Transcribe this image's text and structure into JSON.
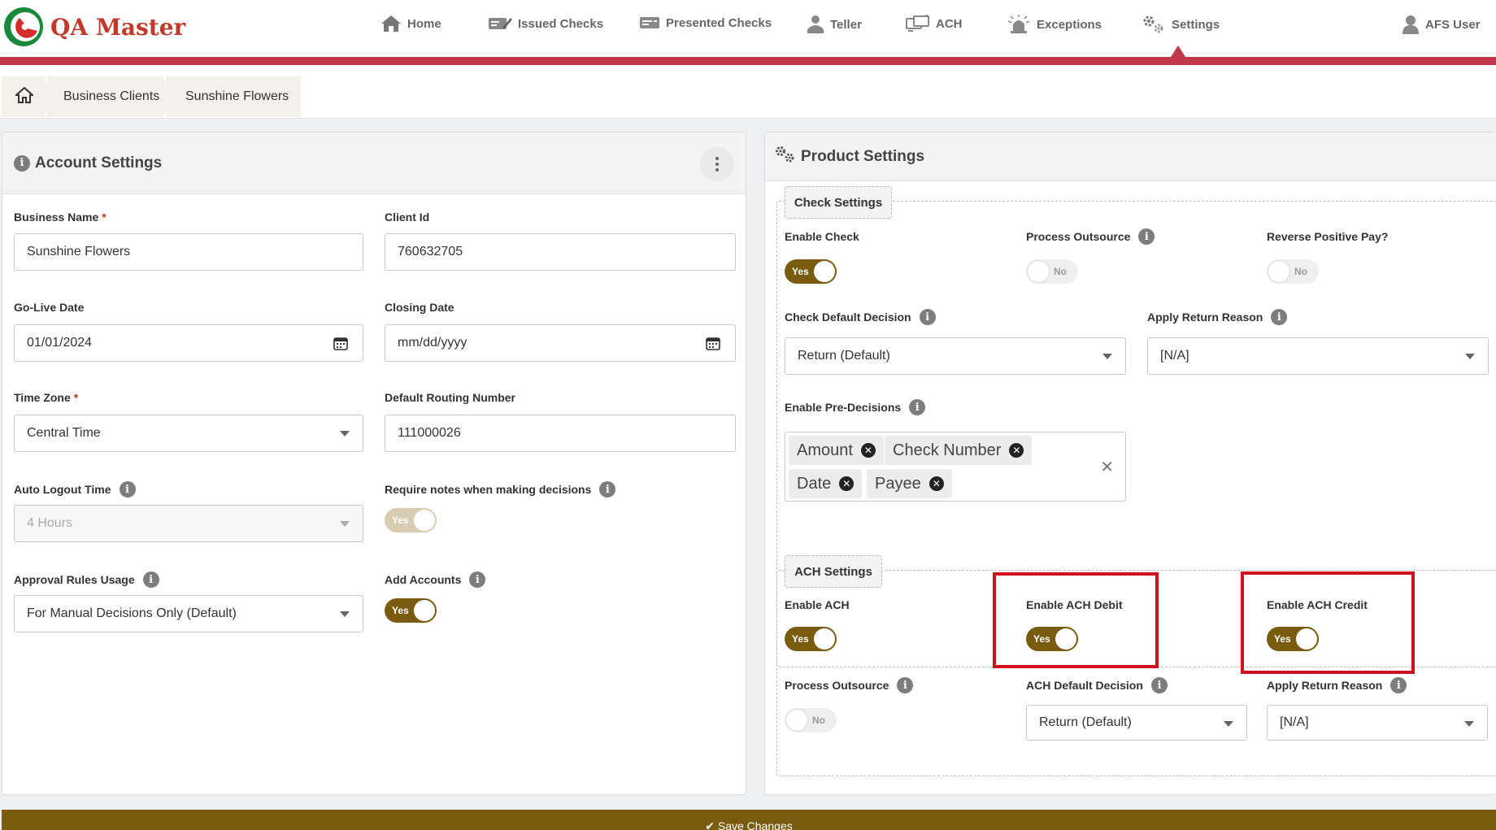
{
  "app": {
    "title": "QA Master"
  },
  "nav": {
    "home": "Home",
    "issued_checks": "Issued Checks",
    "presented_checks": "Presented Checks",
    "teller": "Teller",
    "ach": "ACH",
    "exceptions": "Exceptions",
    "settings": "Settings",
    "user": "AFS User"
  },
  "breadcrumb": {
    "items": [
      "Business Clients",
      "Sunshine Flowers"
    ]
  },
  "account": {
    "title": "Account Settings",
    "business_name_label": "Business Name",
    "business_name_value": "Sunshine Flowers",
    "client_id_label": "Client Id",
    "client_id_value": "760632705",
    "go_live_label": "Go-Live Date",
    "go_live_value": "01/01/2024",
    "closing_label": "Closing Date",
    "closing_placeholder": "mm/dd/yyyy",
    "timezone_label": "Time Zone",
    "timezone_value": "Central Time",
    "routing_label": "Default Routing Number",
    "routing_value": "111000026",
    "auto_logout_label": "Auto Logout Time",
    "auto_logout_value": "4 Hours",
    "require_notes_label": "Require notes when making decisions",
    "require_notes_toggle": "Yes",
    "approval_label": "Approval Rules Usage",
    "approval_value": "For Manual Decisions Only (Default)",
    "add_accounts_label": "Add Accounts",
    "add_accounts_toggle": "Yes",
    "required_mark": "*"
  },
  "product": {
    "title": "Product Settings",
    "check_legend": "Check Settings",
    "enable_check_label": "Enable Check",
    "enable_check_toggle": "Yes",
    "process_outsource_label": "Process Outsource",
    "process_outsource_toggle": "No",
    "reverse_pp_label": "Reverse Positive Pay?",
    "reverse_pp_toggle": "No",
    "check_default_label": "Check Default Decision",
    "check_default_value": "Return (Default)",
    "apply_return_label": "Apply Return Reason",
    "apply_return_value": "[N/A]",
    "pre_decisions_label": "Enable Pre-Decisions",
    "chips": [
      "Amount",
      "Check Number",
      "Date",
      "Payee"
    ],
    "ach_legend": "ACH Settings",
    "enable_ach_label": "Enable ACH",
    "enable_ach_toggle": "Yes",
    "ach_debit_label": "Enable ACH Debit",
    "ach_debit_toggle": "Yes",
    "ach_credit_label": "Enable ACH Credit",
    "ach_credit_toggle": "Yes",
    "ach_outsource_label": "Process Outsource",
    "ach_outsource_toggle": "No",
    "ach_default_label": "ACH Default Decision",
    "ach_default_value": "Return (Default)",
    "ach_return_label": "Apply Return Reason",
    "ach_return_value": "[N/A]"
  },
  "footer": {
    "save_label": "✔ Save Changes"
  },
  "colors": {
    "brand_red": "#c0394a",
    "toggle_on": "#7a5c10",
    "highlight": "#d0101c"
  }
}
